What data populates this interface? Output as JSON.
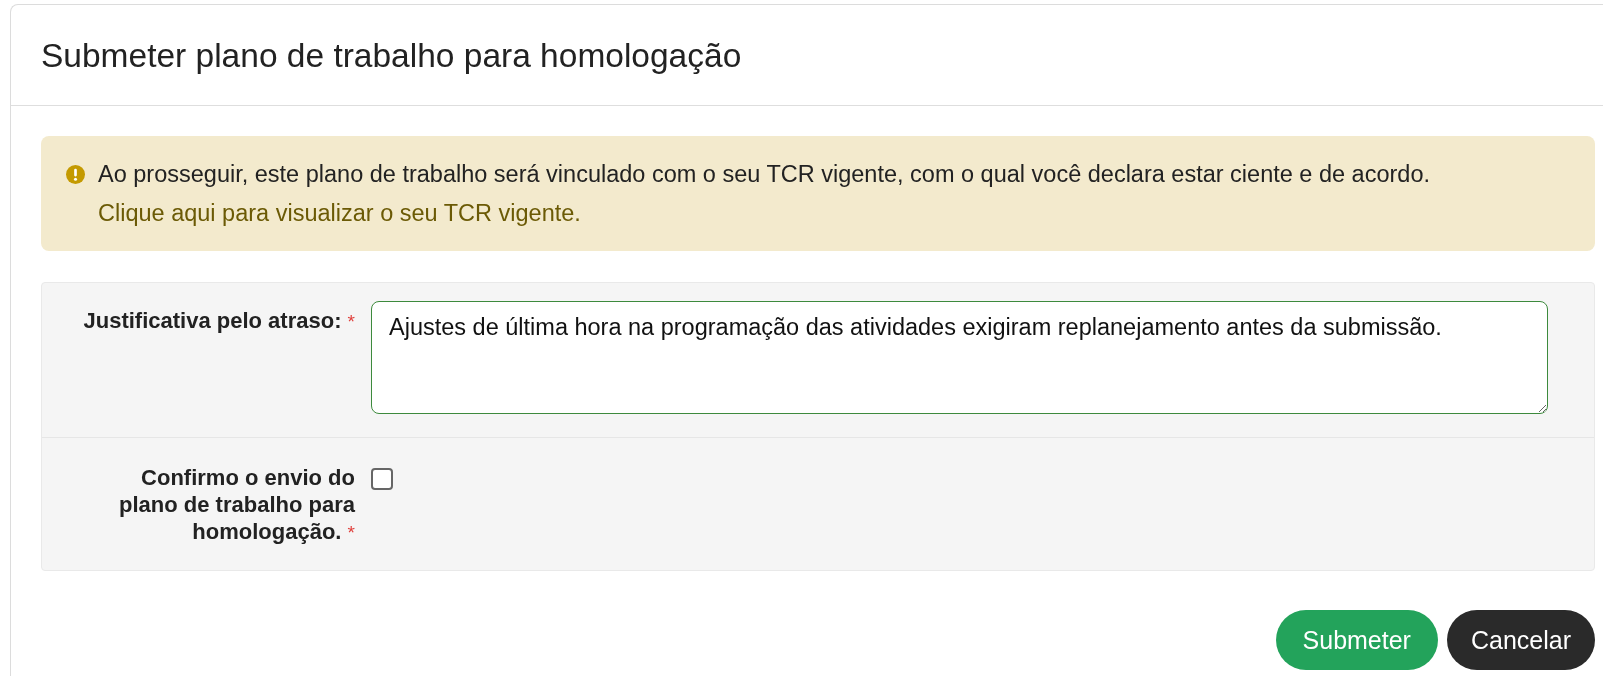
{
  "modal": {
    "title": "Submeter plano de trabalho para homologação"
  },
  "alert": {
    "text": "Ao prosseguir, este plano de trabalho será vinculado com o seu TCR vigente, com o qual você declara estar ciente e de acordo.",
    "link": "Clique aqui para visualizar o seu TCR vigente."
  },
  "fields": [
    {
      "kind": "textarea",
      "label": "Justificativa pelo atraso:",
      "required_mark": "*",
      "value": "Ajustes de última hora na programação das atividades exigiram replanejamento antes da submissão."
    },
    {
      "kind": "checkbox",
      "label": "Confirmo o envio do plano de trabalho para homologação.",
      "required_mark": "*",
      "checked": false
    }
  ],
  "buttons": [
    {
      "label": "Submeter",
      "kind": "primary"
    },
    {
      "label": "Cancelar",
      "kind": "secondary"
    }
  ]
}
